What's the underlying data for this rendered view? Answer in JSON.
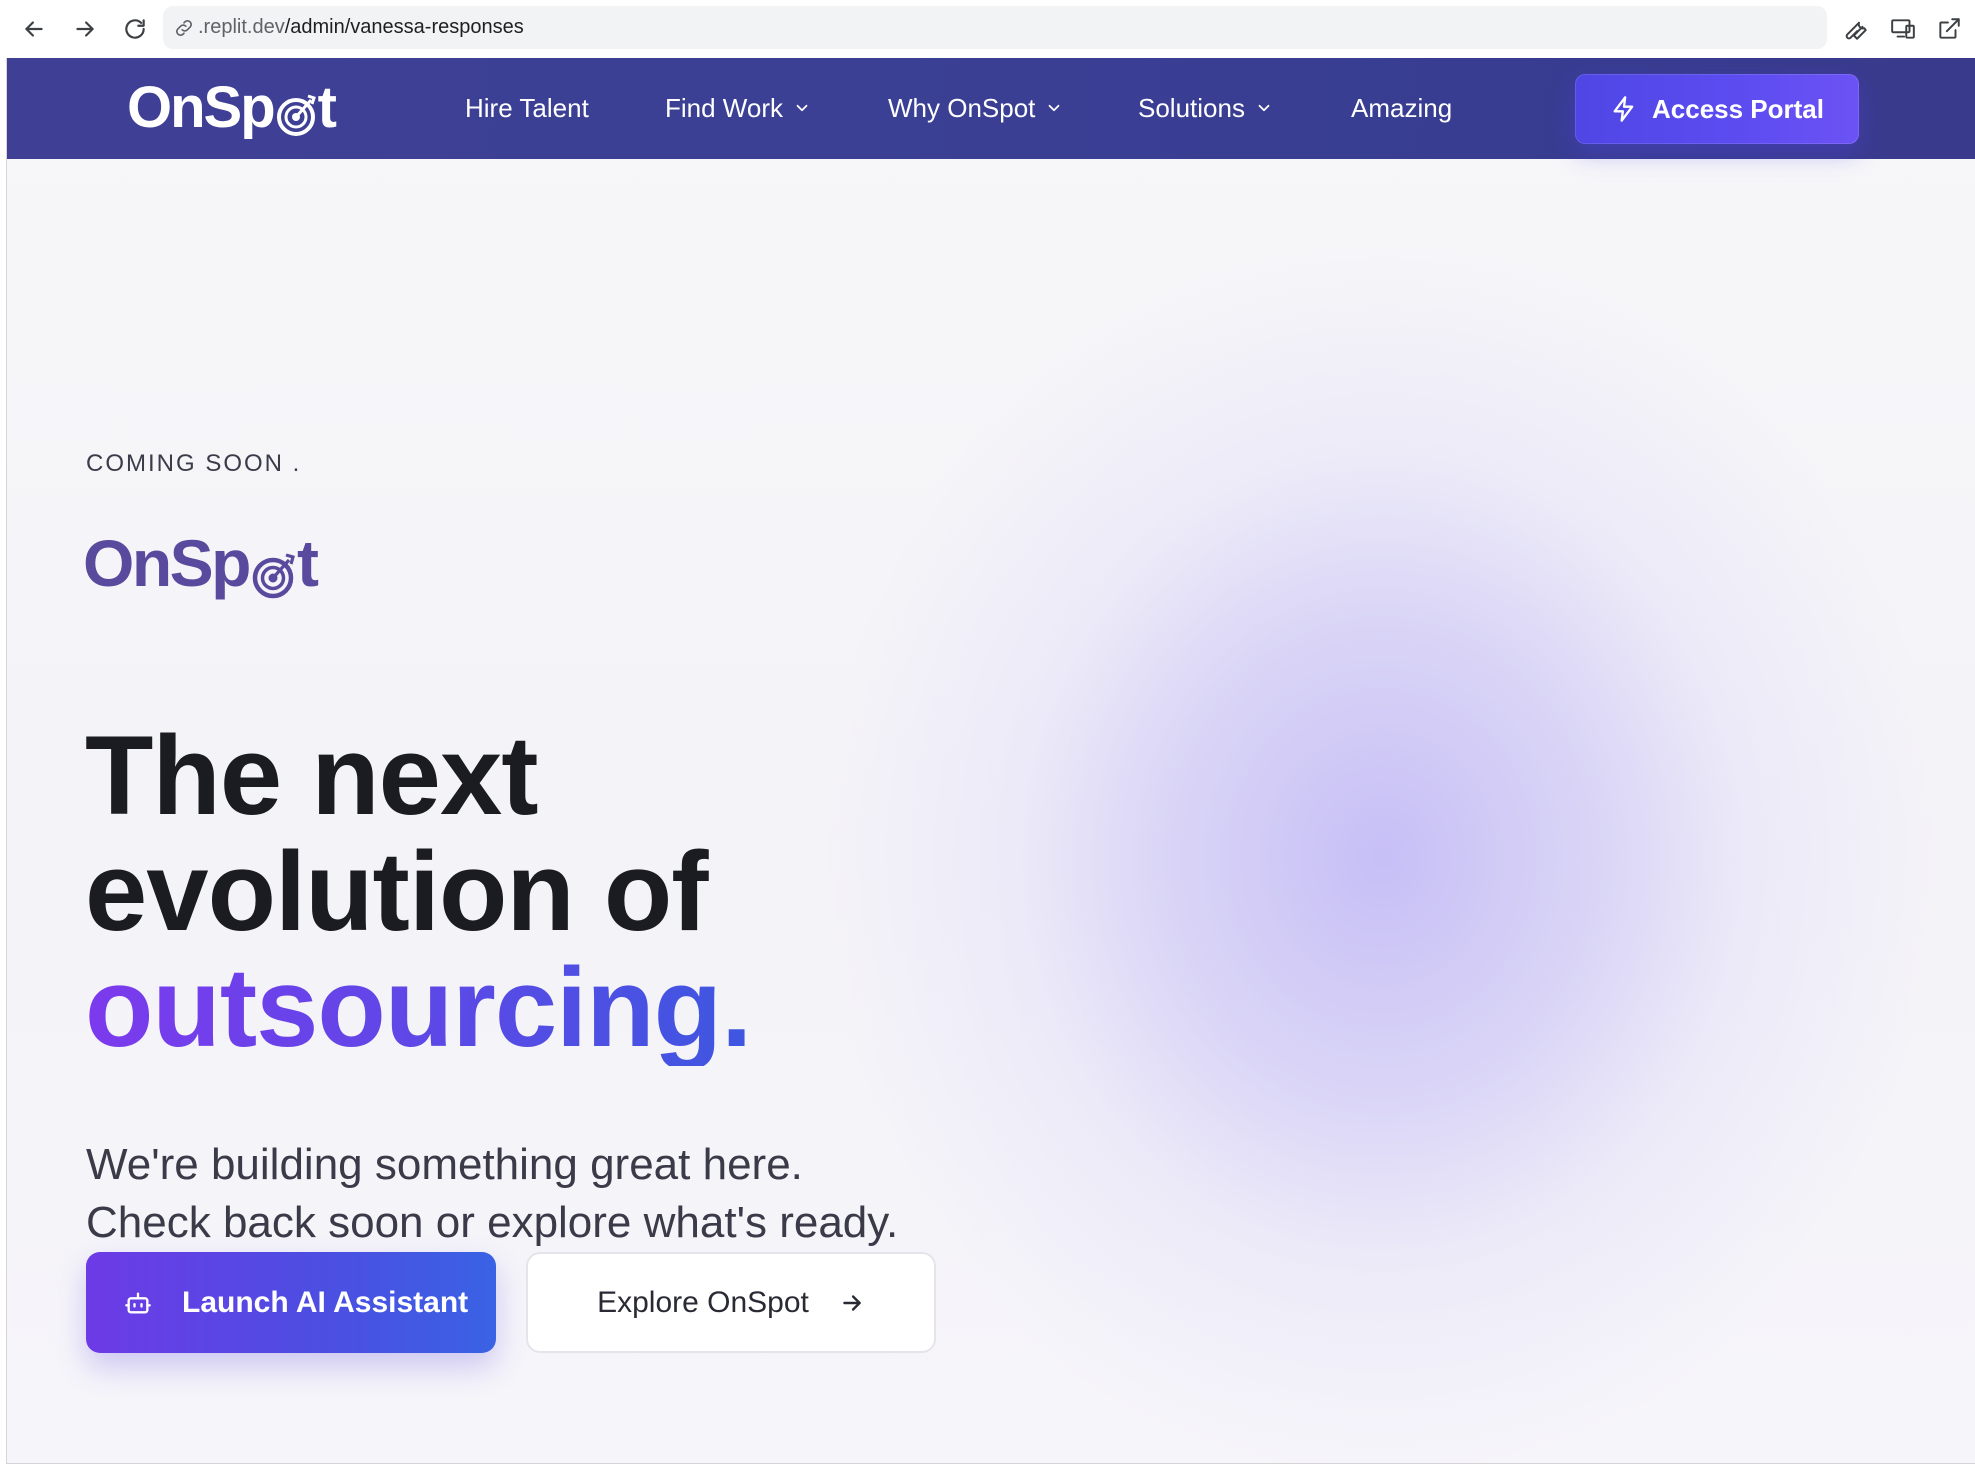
{
  "browser": {
    "url_host": ".replit.dev",
    "url_path": "/admin/vanessa-responses",
    "icons": [
      "back-arrow-icon",
      "forward-arrow-icon",
      "reload-icon",
      "link-icon",
      "wrench-icon",
      "devices-icon",
      "open-external-icon"
    ]
  },
  "header": {
    "logo_text_left": "OnSp",
    "logo_text_right": "t",
    "nav": [
      {
        "label": "Hire Talent",
        "dropdown": false
      },
      {
        "label": "Find Work",
        "dropdown": true
      },
      {
        "label": "Why OnSpot",
        "dropdown": true
      },
      {
        "label": "Solutions",
        "dropdown": true
      },
      {
        "label": "Amazing",
        "dropdown": false
      }
    ],
    "cta_label": "Access Portal",
    "cta_icon": "lightning-bolt-icon"
  },
  "hero": {
    "eyebrow": "COMING SOON .",
    "logo_text_left": "OnSp",
    "logo_text_right": "t",
    "headline_line1": "The next",
    "headline_line2": "evolution of",
    "headline_accent": "outsourcing.",
    "subtext_line1": "We're building something great here.",
    "subtext_line2": "Check back soon or explore what's ready.",
    "primary_label": "Launch AI Assistant",
    "primary_icon": "bot-icon",
    "secondary_label": "Explore OnSpot",
    "secondary_icon": "arrow-right-icon"
  },
  "colors": {
    "header_bg": "#3b4095",
    "brand_purple": "#5a4a9e",
    "accent_gradient_start": "#7c3aed",
    "accent_gradient_end": "#3e57e0",
    "cta_blue": "#4f46e5"
  }
}
